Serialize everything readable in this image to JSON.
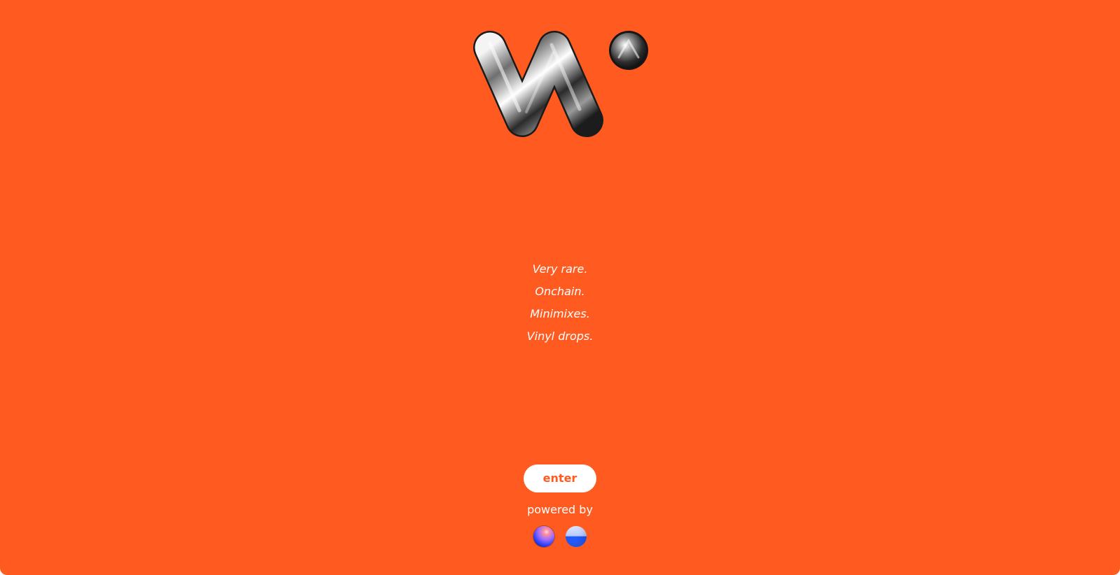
{
  "brand": {
    "logo_icon": "chrome-v-with-dot-logo",
    "background_color": "#ff5b20"
  },
  "tagline": {
    "lines": [
      "Very rare.",
      "Onchain.",
      "Minimixes.",
      "Vinyl drops."
    ]
  },
  "cta": {
    "enter_label": "enter"
  },
  "footer": {
    "powered_by_label": "powered by",
    "partners": [
      {
        "icon": "gradient-sphere-icon"
      },
      {
        "icon": "blue-half-circle-icon"
      }
    ]
  }
}
